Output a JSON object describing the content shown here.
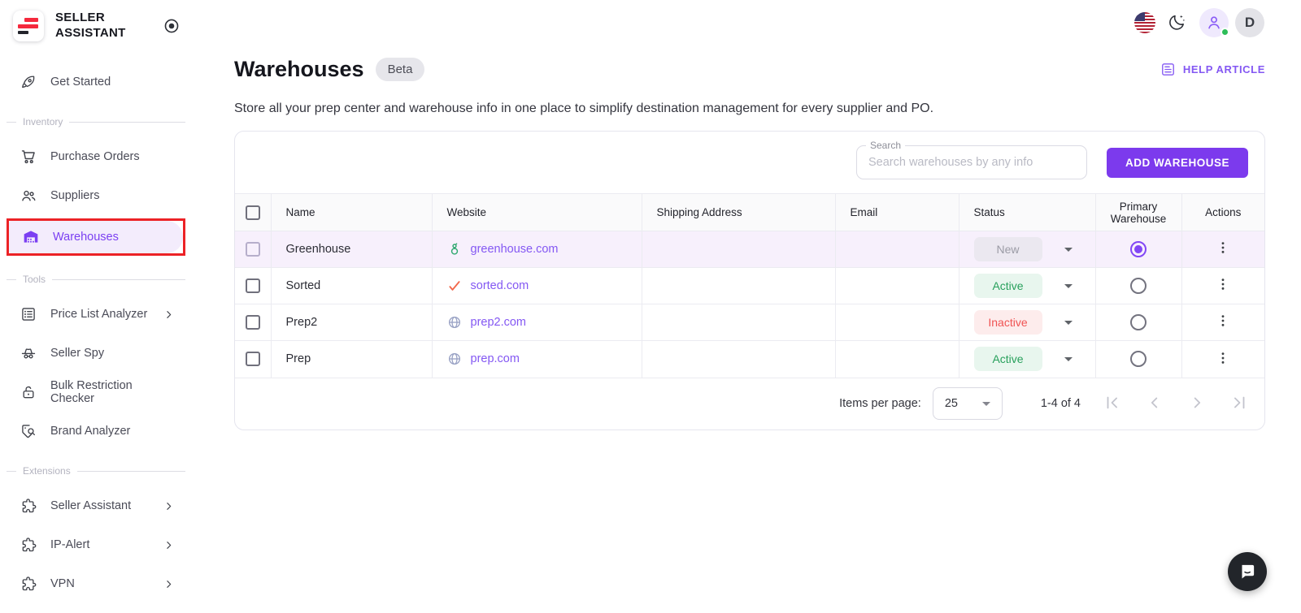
{
  "brand": {
    "line1": "SELLER",
    "line2": "ASSISTANT"
  },
  "topbar": {
    "avatar_initial": "D"
  },
  "sidebar": {
    "get_started": "Get Started",
    "section_inventory": "Inventory",
    "section_tools": "Tools",
    "section_extensions": "Extensions",
    "items": {
      "purchase_orders": "Purchase Orders",
      "suppliers": "Suppliers",
      "warehouses": "Warehouses",
      "price_list_analyzer": "Price List Analyzer",
      "seller_spy": "Seller Spy",
      "bulk_restriction_checker": "Bulk Restriction Checker",
      "brand_analyzer": "Brand Analyzer",
      "seller_assistant": "Seller Assistant",
      "ip_alert": "IP-Alert",
      "vpn": "VPN"
    }
  },
  "page": {
    "title": "Warehouses",
    "badge": "Beta",
    "subtitle": "Store all your prep center and warehouse info in one place to simplify destination management for every supplier and PO.",
    "help_link": "HELP ARTICLE"
  },
  "toolbar": {
    "search_label": "Search",
    "search_placeholder": "Search warehouses by any info",
    "add_button": "ADD WAREHOUSE"
  },
  "table": {
    "columns": {
      "name": "Name",
      "website": "Website",
      "shipping_address": "Shipping Address",
      "email": "Email",
      "status": "Status",
      "primary_warehouse": "Primary Warehouse",
      "actions": "Actions"
    },
    "rows": [
      {
        "name": "Greenhouse",
        "website": "greenhouse.com",
        "shipping_address": "",
        "email": "",
        "status": "New",
        "primary": true,
        "selected": true
      },
      {
        "name": "Sorted",
        "website": "sorted.com",
        "shipping_address": "",
        "email": "",
        "status": "Active",
        "primary": false,
        "selected": false
      },
      {
        "name": "Prep2",
        "website": "prep2.com",
        "shipping_address": "",
        "email": "",
        "status": "Inactive",
        "primary": false,
        "selected": false
      },
      {
        "name": "Prep",
        "website": "prep.com",
        "shipping_address": "",
        "email": "",
        "status": "Active",
        "primary": false,
        "selected": false
      }
    ]
  },
  "pagination": {
    "items_per_page_label": "Items per page:",
    "items_per_page_value": "25",
    "range": "1-4 of 4"
  },
  "colors": {
    "accent": "#7c3aed",
    "link": "#8458f3",
    "status_new_text": "#9b9ba5",
    "status_active_text": "#28a05c",
    "status_inactive_text": "#f05353",
    "annotation_red": "#ec2226",
    "logo_red": "#f5293d"
  }
}
